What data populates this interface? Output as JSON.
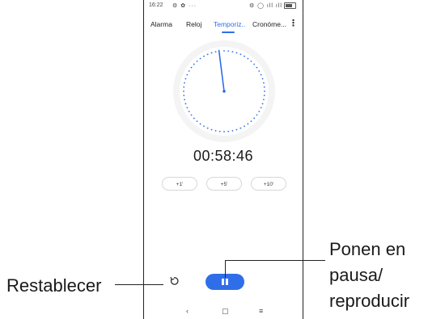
{
  "status_bar": {
    "time": "16:22",
    "indicators": "⚙ ✿ ···",
    "right": "⚙ ◯ ıll ıll"
  },
  "tabs": [
    {
      "label": "Alarma"
    },
    {
      "label": "Reloj"
    },
    {
      "label": "Temporiz..",
      "active": true
    },
    {
      "label": "Cronóme..."
    }
  ],
  "timer": {
    "display": "00:58:46",
    "hand_fraction": 0.98
  },
  "quick_add": {
    "one": "+1'",
    "five": "+5'",
    "ten": "+10'"
  },
  "nav_bar": {
    "back": "‹",
    "home": "▢",
    "recents": "≡"
  },
  "annotations": {
    "reset": "Restablecer",
    "pause_line1": "Ponen en",
    "pause_line2": "pausa/",
    "pause_line3": "reproducir"
  },
  "colors": {
    "accent": "#2f6ee8"
  }
}
